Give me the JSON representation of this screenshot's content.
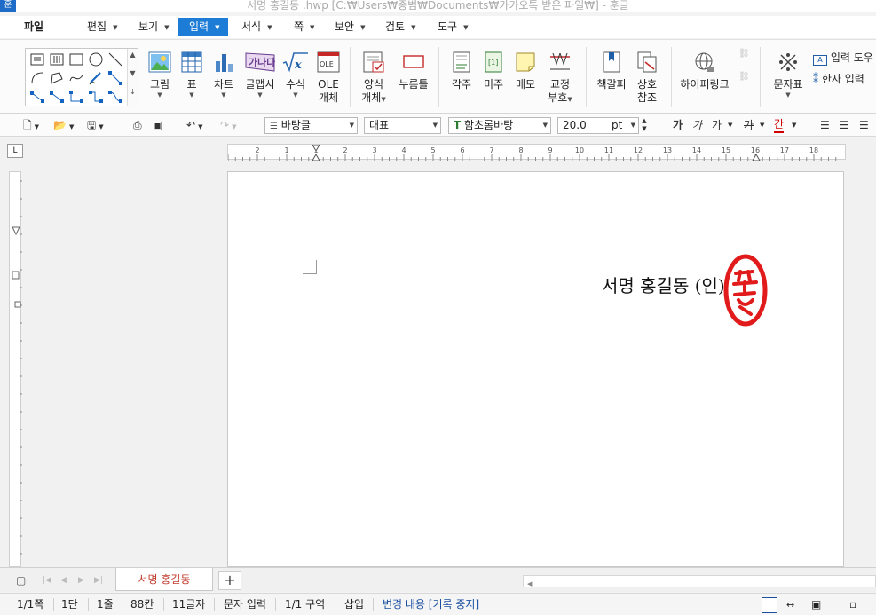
{
  "window": {
    "app_icon": "훈",
    "title": "서명 홍길동 .hwp [C:₩Users₩종범₩Documents₩카카오톡 받은 파일₩] - 훈글"
  },
  "menu": {
    "file": "파일",
    "items": [
      {
        "label": "편집"
      },
      {
        "label": "보기"
      },
      {
        "label": "입력"
      },
      {
        "label": "서식"
      },
      {
        "label": "쪽"
      },
      {
        "label": "보안"
      },
      {
        "label": "검토"
      },
      {
        "label": "도구"
      }
    ],
    "active": "입력",
    "accent_color": "#1d7cd6"
  },
  "ribbon": {
    "picture": "그림",
    "table": "표",
    "chart": "차트",
    "glyph_line1": "글맵시",
    "formula": "수식",
    "ole_line1": "OLE",
    "ole_line2": "개체",
    "form_line1": "양식",
    "form_line2": "개체",
    "button": "누름틀",
    "footnote": "각주",
    "endnote": "미주",
    "memo": "메모",
    "proof_line1": "교정",
    "proof_line2": "부호",
    "bookmark": "책갈피",
    "crossref_line1": "상호",
    "crossref_line2": "참조",
    "hyperlink": "하이퍼링크",
    "charmap": "문자표",
    "input_helper": "입력 도우",
    "hanja_input": "한자 입력",
    "ole_icon_text": "OLE",
    "glyph_icon_text": "가나다"
  },
  "format_toolbar": {
    "style": "바탕글",
    "font_lang": "대표",
    "font_name": "함초롬바탕",
    "font_size": "20.0",
    "font_unit": "pt",
    "bold": "가",
    "italic": "가",
    "underline": "가",
    "strike": "가",
    "color_char": "간",
    "font_color": "#d00000"
  },
  "ruler": {
    "h_ticks": [
      "2",
      "1",
      "1",
      "2",
      "3",
      "4",
      "5",
      "6",
      "7",
      "8",
      "9",
      "10",
      "11",
      "12",
      "13",
      "14",
      "15",
      "16",
      "17",
      "18"
    ]
  },
  "document": {
    "text": "서명  홍길동 (인)",
    "seal_color": "#e11b1b"
  },
  "tabs": {
    "doc_tab": "서명 홍길동",
    "add": "+"
  },
  "status": {
    "page": "1/1쪽",
    "column": "1단",
    "line": "1줄",
    "cell": "88칸",
    "chars": "11글자",
    "mode": "문자 입력",
    "section": "1/1 구역",
    "insert": "삽입",
    "track": "변경 내용 [기록 중지]",
    "track_color": "#1a4fa0"
  }
}
